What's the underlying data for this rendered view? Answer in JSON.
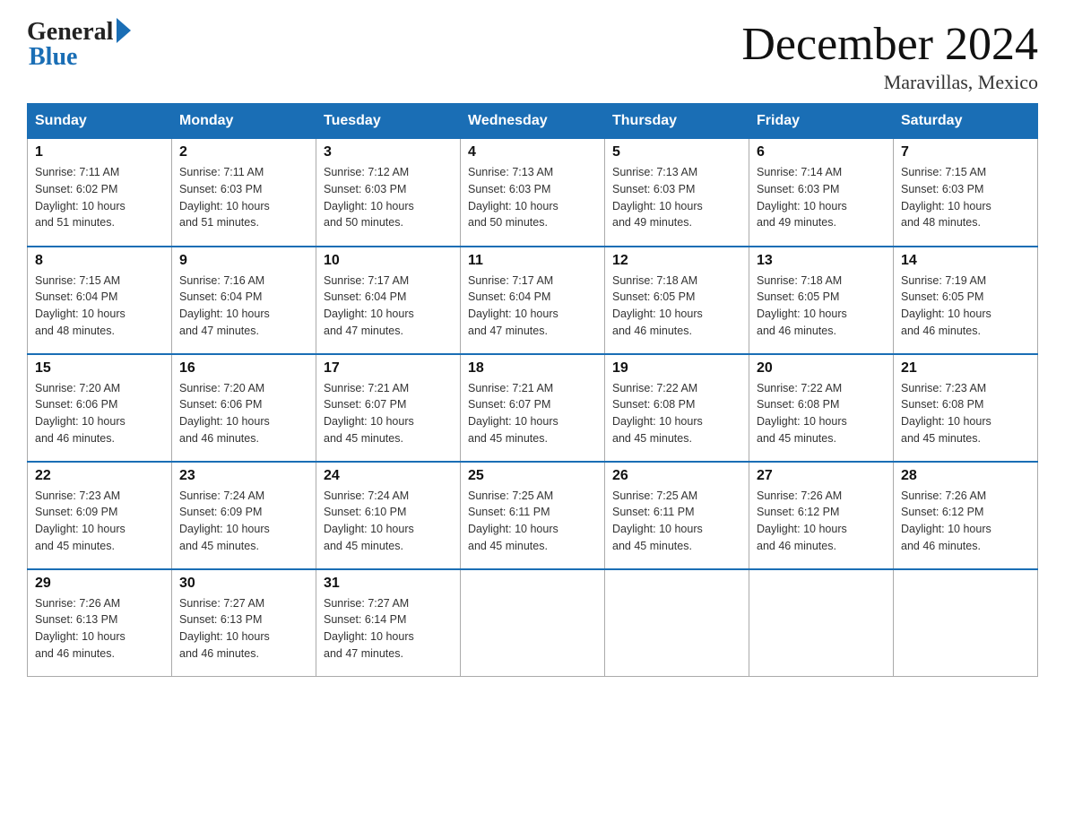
{
  "header": {
    "logo_general": "General",
    "logo_blue": "Blue",
    "month_title": "December 2024",
    "location": "Maravillas, Mexico"
  },
  "days_of_week": [
    "Sunday",
    "Monday",
    "Tuesday",
    "Wednesday",
    "Thursday",
    "Friday",
    "Saturday"
  ],
  "weeks": [
    [
      {
        "num": "1",
        "sunrise": "7:11 AM",
        "sunset": "6:02 PM",
        "daylight": "10 hours and 51 minutes."
      },
      {
        "num": "2",
        "sunrise": "7:11 AM",
        "sunset": "6:03 PM",
        "daylight": "10 hours and 51 minutes."
      },
      {
        "num": "3",
        "sunrise": "7:12 AM",
        "sunset": "6:03 PM",
        "daylight": "10 hours and 50 minutes."
      },
      {
        "num": "4",
        "sunrise": "7:13 AM",
        "sunset": "6:03 PM",
        "daylight": "10 hours and 50 minutes."
      },
      {
        "num": "5",
        "sunrise": "7:13 AM",
        "sunset": "6:03 PM",
        "daylight": "10 hours and 49 minutes."
      },
      {
        "num": "6",
        "sunrise": "7:14 AM",
        "sunset": "6:03 PM",
        "daylight": "10 hours and 49 minutes."
      },
      {
        "num": "7",
        "sunrise": "7:15 AM",
        "sunset": "6:03 PM",
        "daylight": "10 hours and 48 minutes."
      }
    ],
    [
      {
        "num": "8",
        "sunrise": "7:15 AM",
        "sunset": "6:04 PM",
        "daylight": "10 hours and 48 minutes."
      },
      {
        "num": "9",
        "sunrise": "7:16 AM",
        "sunset": "6:04 PM",
        "daylight": "10 hours and 47 minutes."
      },
      {
        "num": "10",
        "sunrise": "7:17 AM",
        "sunset": "6:04 PM",
        "daylight": "10 hours and 47 minutes."
      },
      {
        "num": "11",
        "sunrise": "7:17 AM",
        "sunset": "6:04 PM",
        "daylight": "10 hours and 47 minutes."
      },
      {
        "num": "12",
        "sunrise": "7:18 AM",
        "sunset": "6:05 PM",
        "daylight": "10 hours and 46 minutes."
      },
      {
        "num": "13",
        "sunrise": "7:18 AM",
        "sunset": "6:05 PM",
        "daylight": "10 hours and 46 minutes."
      },
      {
        "num": "14",
        "sunrise": "7:19 AM",
        "sunset": "6:05 PM",
        "daylight": "10 hours and 46 minutes."
      }
    ],
    [
      {
        "num": "15",
        "sunrise": "7:20 AM",
        "sunset": "6:06 PM",
        "daylight": "10 hours and 46 minutes."
      },
      {
        "num": "16",
        "sunrise": "7:20 AM",
        "sunset": "6:06 PM",
        "daylight": "10 hours and 46 minutes."
      },
      {
        "num": "17",
        "sunrise": "7:21 AM",
        "sunset": "6:07 PM",
        "daylight": "10 hours and 45 minutes."
      },
      {
        "num": "18",
        "sunrise": "7:21 AM",
        "sunset": "6:07 PM",
        "daylight": "10 hours and 45 minutes."
      },
      {
        "num": "19",
        "sunrise": "7:22 AM",
        "sunset": "6:08 PM",
        "daylight": "10 hours and 45 minutes."
      },
      {
        "num": "20",
        "sunrise": "7:22 AM",
        "sunset": "6:08 PM",
        "daylight": "10 hours and 45 minutes."
      },
      {
        "num": "21",
        "sunrise": "7:23 AM",
        "sunset": "6:08 PM",
        "daylight": "10 hours and 45 minutes."
      }
    ],
    [
      {
        "num": "22",
        "sunrise": "7:23 AM",
        "sunset": "6:09 PM",
        "daylight": "10 hours and 45 minutes."
      },
      {
        "num": "23",
        "sunrise": "7:24 AM",
        "sunset": "6:09 PM",
        "daylight": "10 hours and 45 minutes."
      },
      {
        "num": "24",
        "sunrise": "7:24 AM",
        "sunset": "6:10 PM",
        "daylight": "10 hours and 45 minutes."
      },
      {
        "num": "25",
        "sunrise": "7:25 AM",
        "sunset": "6:11 PM",
        "daylight": "10 hours and 45 minutes."
      },
      {
        "num": "26",
        "sunrise": "7:25 AM",
        "sunset": "6:11 PM",
        "daylight": "10 hours and 45 minutes."
      },
      {
        "num": "27",
        "sunrise": "7:26 AM",
        "sunset": "6:12 PM",
        "daylight": "10 hours and 46 minutes."
      },
      {
        "num": "28",
        "sunrise": "7:26 AM",
        "sunset": "6:12 PM",
        "daylight": "10 hours and 46 minutes."
      }
    ],
    [
      {
        "num": "29",
        "sunrise": "7:26 AM",
        "sunset": "6:13 PM",
        "daylight": "10 hours and 46 minutes."
      },
      {
        "num": "30",
        "sunrise": "7:27 AM",
        "sunset": "6:13 PM",
        "daylight": "10 hours and 46 minutes."
      },
      {
        "num": "31",
        "sunrise": "7:27 AM",
        "sunset": "6:14 PM",
        "daylight": "10 hours and 47 minutes."
      },
      null,
      null,
      null,
      null
    ]
  ],
  "labels": {
    "sunrise": "Sunrise:",
    "sunset": "Sunset:",
    "daylight": "Daylight:"
  }
}
